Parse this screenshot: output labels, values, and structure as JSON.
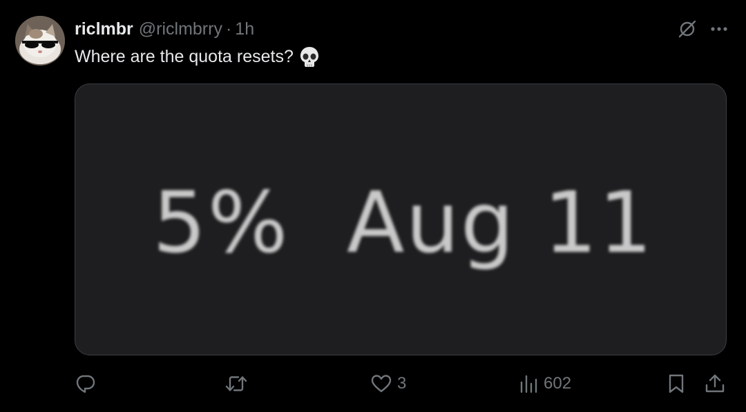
{
  "post": {
    "display_name": "riclmbr",
    "handle": "@riclmbrry",
    "separator": "·",
    "timestamp": "1h",
    "text": "Where are the quota resets?",
    "emoji": "skull-emoji"
  },
  "media": {
    "percent": "5%",
    "date": "Aug 11"
  },
  "actions": {
    "replies_count": "",
    "reposts_count": "",
    "likes_count": "3",
    "views_count": "602"
  },
  "icons": {
    "grok": "grok-icon",
    "more": "more-icon",
    "reply": "reply-icon",
    "repost": "repost-icon",
    "like": "heart-icon",
    "views": "views-icon",
    "bookmark": "bookmark-icon",
    "share": "share-icon"
  },
  "colors": {
    "background": "#000000",
    "text_primary": "#e7e9ea",
    "text_secondary": "#71767b",
    "media_background": "#1e1e20",
    "media_border": "#3a3d41"
  }
}
